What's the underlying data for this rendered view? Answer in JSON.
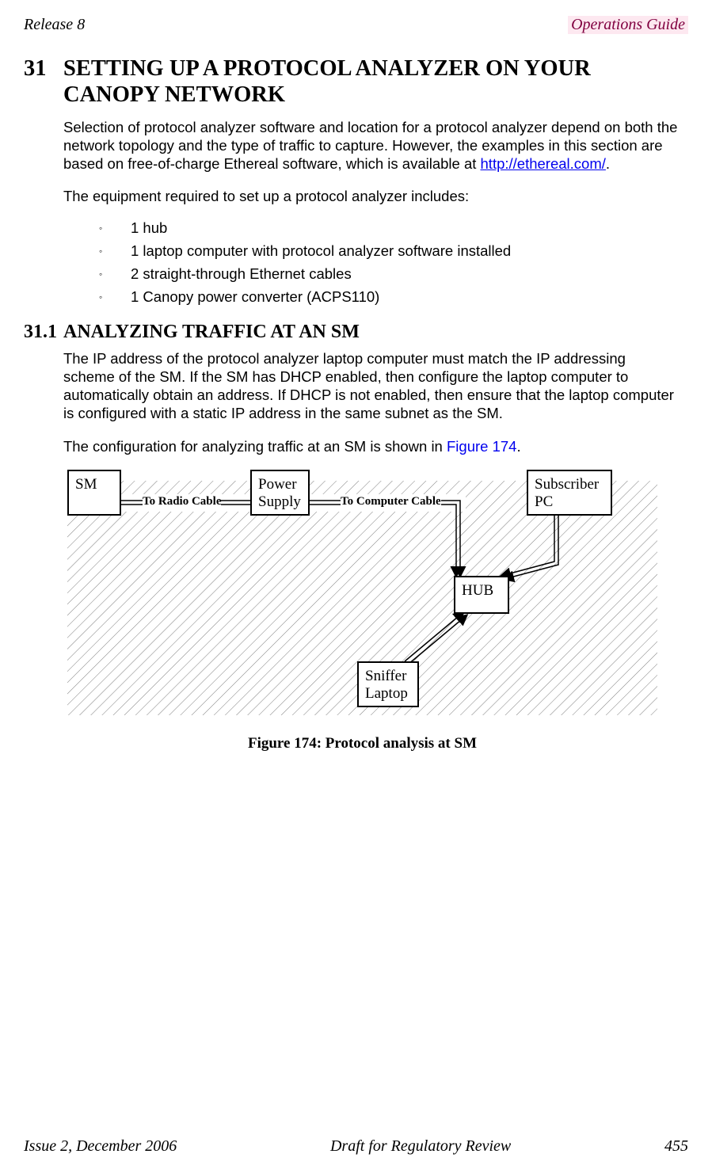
{
  "header": {
    "left": "Release 8",
    "right": "Operations Guide"
  },
  "h1": {
    "num": "31",
    "title": "SETTING UP A PROTOCOL ANALYZER ON YOUR CANOPY NETWORK"
  },
  "p1a": "Selection of protocol analyzer software and location for a protocol analyzer depend on both the network topology and the type of traffic to capture. However, the examples in this section are based on free-of-charge Ethereal software, which is available at ",
  "p1_link": "http://ethereal.com/",
  "p1b": ".",
  "p2": "The equipment required to set up a protocol analyzer includes:",
  "bullets": [
    "1 hub",
    "1 laptop computer with protocol analyzer software installed",
    "2 straight-through Ethernet cables",
    "1 Canopy power converter (ACPS110)"
  ],
  "h2": {
    "num": "31.1",
    "title": "ANALYZING TRAFFIC AT AN SM"
  },
  "p3": "The IP address of the protocol analyzer laptop computer must match the IP addressing scheme of the SM. If the SM has DHCP enabled, then configure the laptop computer to automatically obtain an address. If DHCP is not enabled, then ensure that the laptop computer is configured with a static IP address in the same subnet as the SM.",
  "p4a": "The configuration for analyzing traffic at an SM is shown in ",
  "p4_ref": "Figure 174",
  "p4b": ".",
  "diagram": {
    "sm": "SM",
    "radio_cable": "To Radio Cable",
    "power_supply": "Power\nSupply",
    "computer_cable": "To Computer Cable",
    "subscriber_pc": "Subscriber\nPC",
    "hub": "HUB",
    "sniffer": "Sniffer\nLaptop"
  },
  "caption": "Figure 174: Protocol analysis at SM",
  "footer": {
    "left": "Issue 2, December 2006",
    "center": "Draft for Regulatory Review",
    "right": "455"
  }
}
